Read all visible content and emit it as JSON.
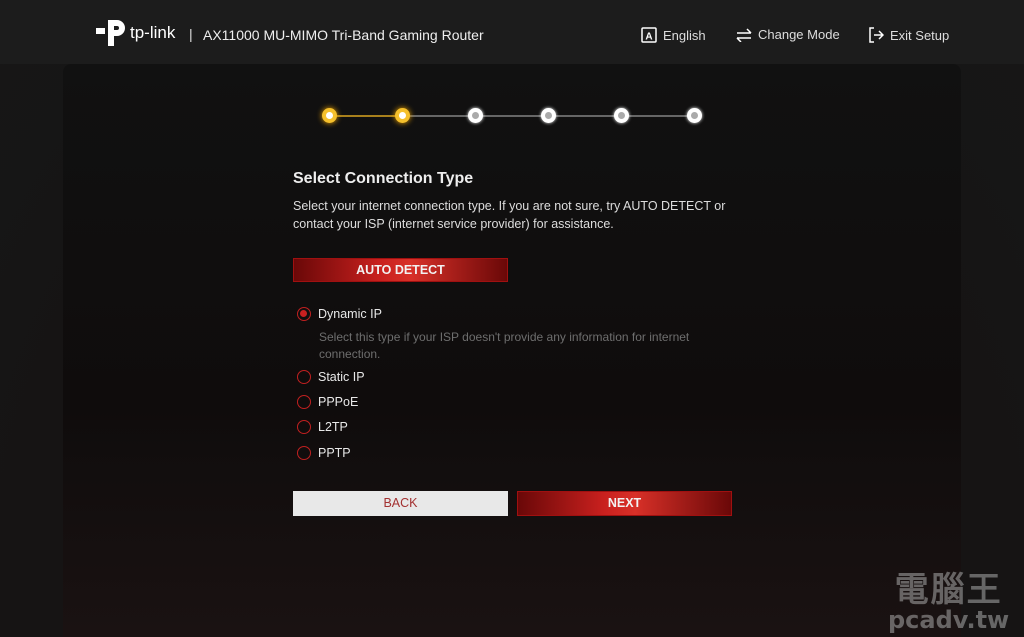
{
  "header": {
    "brand": "tp-link",
    "separator": "|",
    "model": "AX11000 MU-MIMO Tri-Band Gaming Router",
    "nav": [
      {
        "label": "English",
        "icon": "language-icon"
      },
      {
        "label": "Change Mode",
        "icon": "swap-arrows-icon"
      },
      {
        "label": "Exit Setup",
        "icon": "exit-icon"
      }
    ]
  },
  "progress": {
    "total_steps": 6,
    "current_step": 2,
    "active_color": "#f5c02c"
  },
  "main": {
    "title": "Select Connection Type",
    "description": "Select your internet connection type. If you are not sure, try AUTO DETECT or contact your ISP (internet service provider) for assistance.",
    "auto_detect_label": "AUTO DETECT",
    "options": [
      {
        "label": "Dynamic IP",
        "selected": true
      },
      {
        "label": "Static IP",
        "selected": false
      },
      {
        "label": "PPPoE",
        "selected": false
      },
      {
        "label": "L2TP",
        "selected": false
      },
      {
        "label": "PPTP",
        "selected": false
      }
    ],
    "selected_hint": "Select this type if your ISP doesn't provide any information for internet connection.",
    "back_label": "BACK",
    "next_label": "NEXT"
  },
  "watermark": {
    "line1": "電腦王",
    "line2": "pcadv.tw"
  },
  "colors": {
    "accent": "#c82020",
    "step_active": "#f5c02c"
  }
}
